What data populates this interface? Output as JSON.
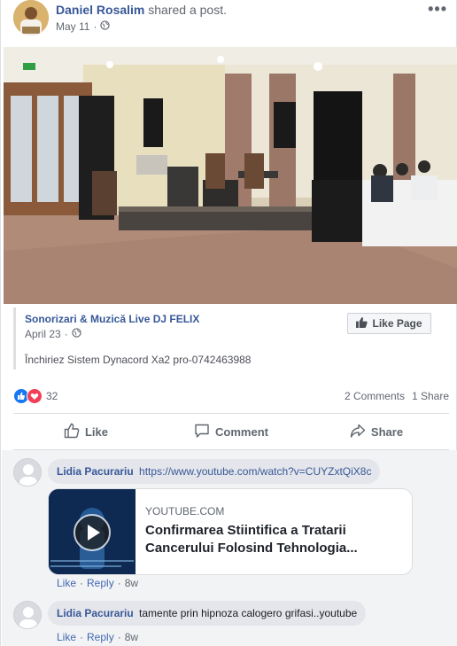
{
  "post": {
    "author": "Daniel Rosalim",
    "action": "shared a post.",
    "date": "May 11",
    "more": "•••",
    "audience_icon": "globe-icon"
  },
  "shared_post": {
    "page_name": "Sonorizari & Muzică Live DJ FELIX",
    "date": "April 23",
    "text": "Închiriez Sistem Dynacord Xa2 pro-0742463988",
    "like_page_label": "Like Page"
  },
  "reactions": {
    "icons": [
      "like-reaction-icon",
      "love-reaction-icon"
    ],
    "count": "32",
    "comments": "2 Comments",
    "shares": "1 Share"
  },
  "actions": {
    "like": "Like",
    "comment": "Comment",
    "share": "Share"
  },
  "comments": [
    {
      "author": "Lidia Pacurariu",
      "text": "https://www.youtube.com/watch?v=CUYZxtQiX8c",
      "like": "Like",
      "reply": "Reply",
      "time": "8w",
      "preview": {
        "domain": "YOUTUBE.COM",
        "title": "Confirmarea Stiintifica a Tratarii Cancerului Folosind Tehnologia..."
      }
    },
    {
      "author": "Lidia Pacurariu",
      "text": "tamente prin hipnoza calogero grifasi..youtube",
      "like": "Like",
      "reply": "Reply",
      "time": "8w"
    }
  ],
  "colors": {
    "link_blue": "#385898",
    "like_blue": "#1877f2",
    "love_red": "#f33e58",
    "comment_bg": "#e4e6eb"
  }
}
